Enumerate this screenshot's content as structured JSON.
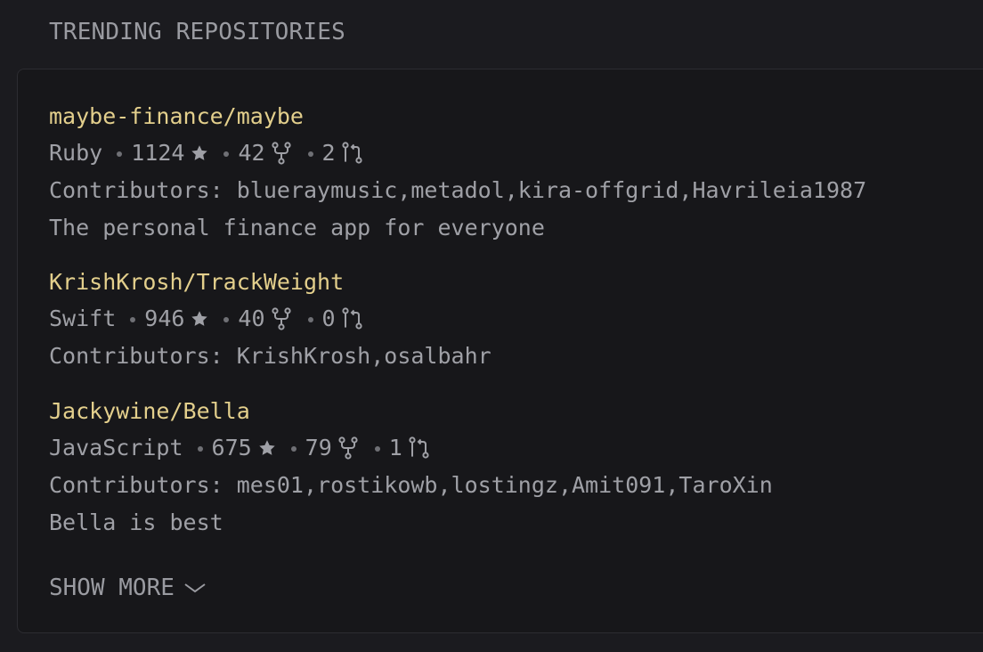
{
  "section": {
    "title": "TRENDING REPOSITORIES"
  },
  "repos": [
    {
      "name": "maybe-finance/maybe",
      "language": "Ruby",
      "stars": "1124",
      "forks": "42",
      "pull_requests": "2",
      "contributors": "Contributors: blueraymusic,metadol,kira-offgrid,Havrileia1987",
      "description": "The personal finance app for everyone"
    },
    {
      "name": "KrishKrosh/TrackWeight",
      "language": "Swift",
      "stars": "946",
      "forks": "40",
      "pull_requests": "0",
      "contributors": "Contributors: KrishKrosh,osalbahr",
      "description": ""
    },
    {
      "name": "Jackywine/Bella",
      "language": "JavaScript",
      "stars": "675",
      "forks": "79",
      "pull_requests": "1",
      "contributors": "Contributors: mes01,rostikowb,lostingz,Amit091,TaroXin",
      "description": "Bella is best"
    }
  ],
  "footer": {
    "show_more_label": "SHOW MORE"
  },
  "icons": {
    "star": "star-icon",
    "fork": "fork-icon",
    "pull_request": "pull-request-icon",
    "chevron": "chevron-down-icon"
  },
  "colors": {
    "repo_name": "#e3cf8c",
    "text_muted": "#9fa0a6",
    "background": "#1b1b1f",
    "panel": "#17171a"
  }
}
